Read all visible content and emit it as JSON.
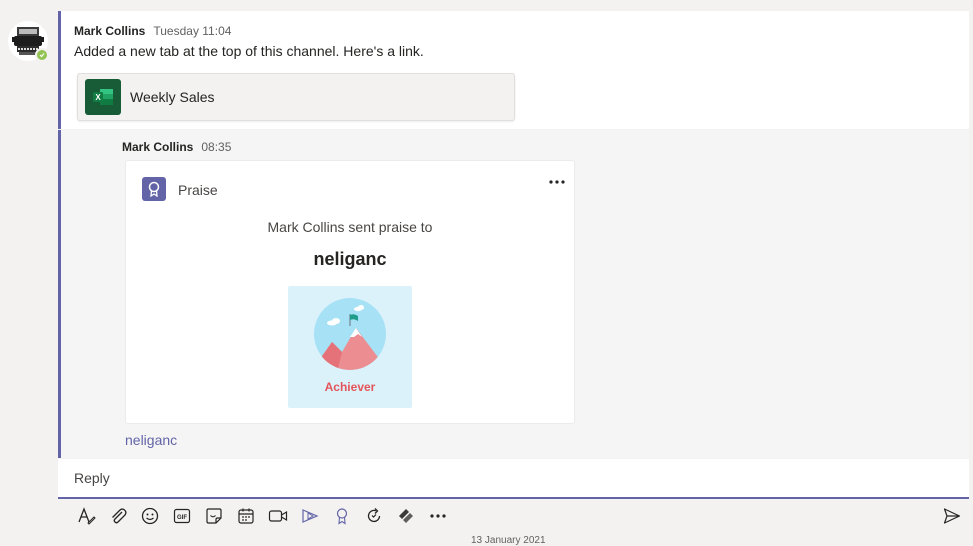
{
  "root_post": {
    "author": "Mark Collins",
    "time": "Tuesday 11:04",
    "text": "Added a new tab at the top of this channel. Here's a link.",
    "tab_card": {
      "title": "Weekly Sales",
      "icon": "excel-icon"
    }
  },
  "reply_post": {
    "author": "Mark Collins",
    "time": "08:35",
    "praise": {
      "label": "Praise",
      "sent_text": "Mark Collins sent praise to",
      "recipient": "neliganc",
      "badge": "Achiever"
    },
    "mention": "neliganc"
  },
  "reply_box": {
    "placeholder": "Reply"
  },
  "composer_toolbar": [
    "format-icon",
    "attach-icon",
    "emoji-icon",
    "gif-icon",
    "sticker-icon",
    "schedule-meeting-icon",
    "meet-now-icon",
    "stream-icon",
    "praise-icon",
    "loop-icon",
    "app-icon",
    "more-options-icon"
  ],
  "date_separator": "13 January 2021",
  "colors": {
    "accent": "#6264a7",
    "presence_available": "#92c353",
    "excel_green": "#185c37",
    "badge_bg": "#dbf2fb",
    "badge_text": "#e4545a"
  }
}
